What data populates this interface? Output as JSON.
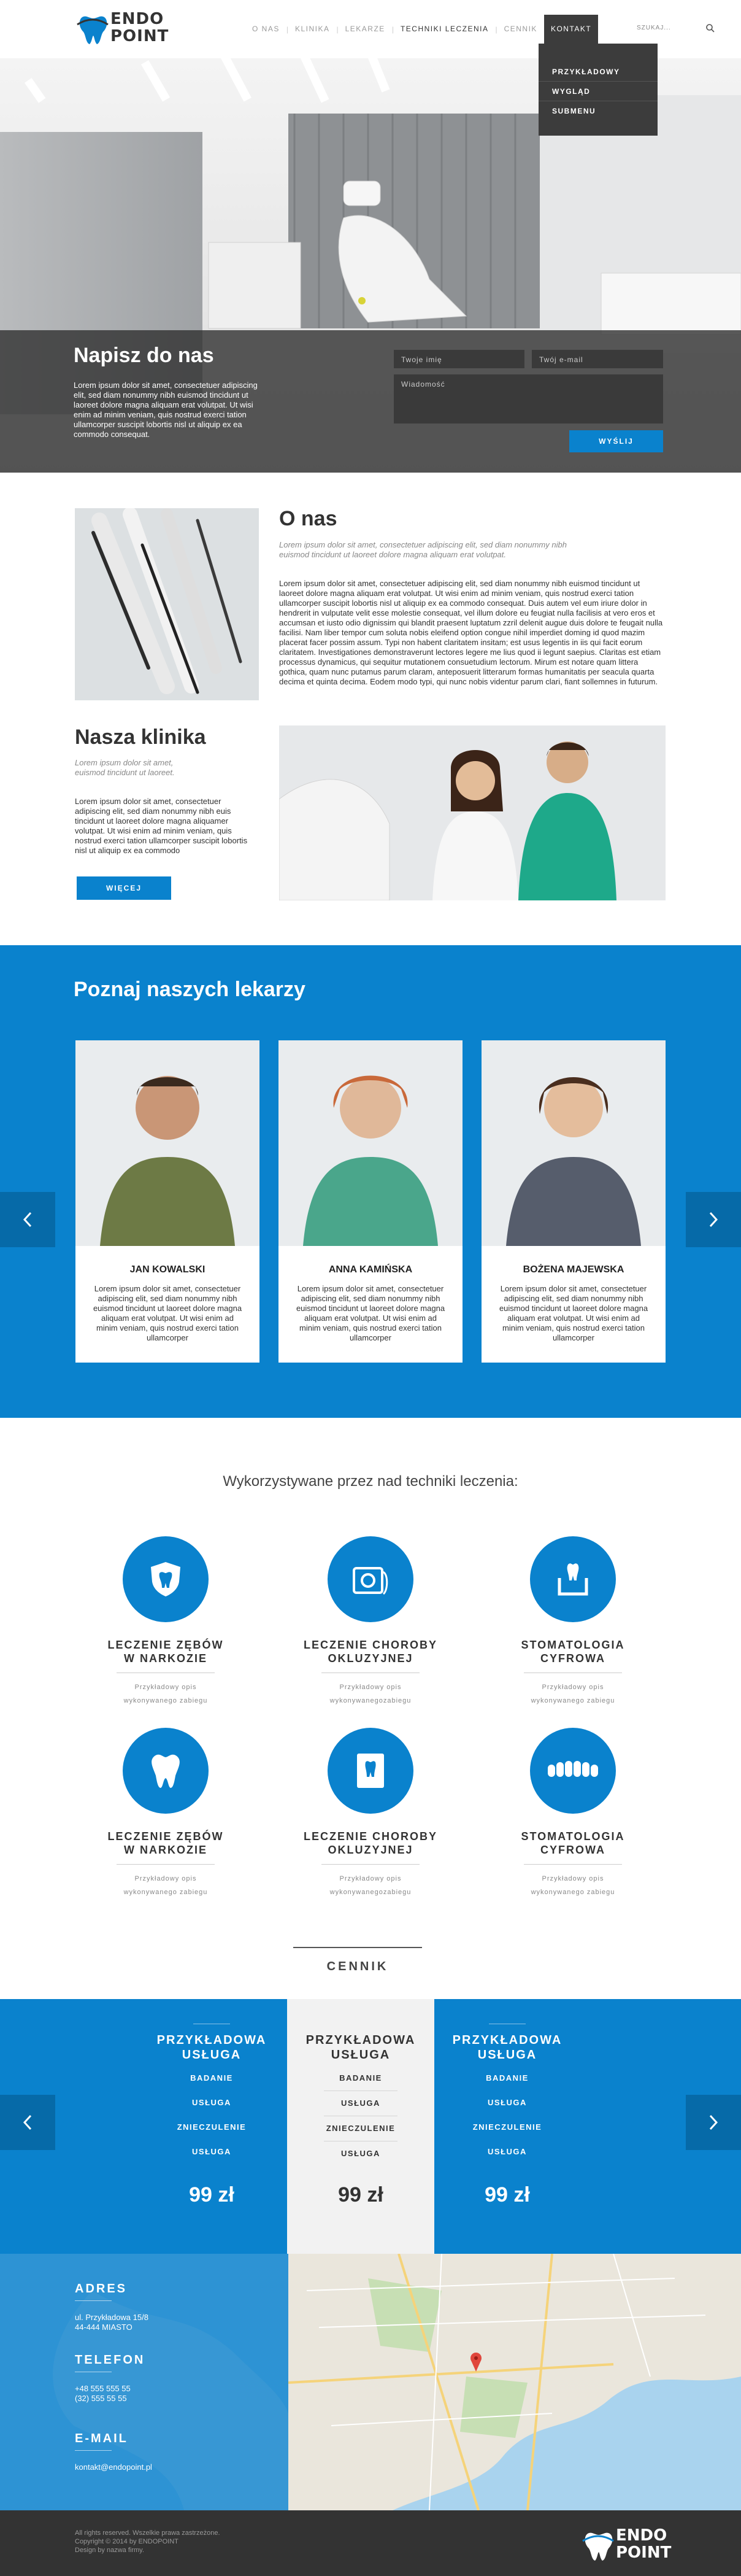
{
  "brand": {
    "line1": "ENDO",
    "line2": "POINT"
  },
  "nav": {
    "items": [
      "O NAS",
      "KLINIKA",
      "LEKARZE",
      "TECHNIKI LECZENIA",
      "CENNIK",
      "KONTAKT"
    ],
    "search_label": "SZUKAJ..."
  },
  "dropdown": {
    "items": [
      "PRZYKŁADOWY",
      "WYGLĄD",
      "SUBMENU"
    ]
  },
  "hero": {
    "title": "Napisz do nas",
    "text": "Lorem ipsum dolor sit amet, consectetuer adipiscing elit, sed diam nonummy nibh euismod tincidunt ut laoreet dolore magna aliquam erat volutpat. Ut wisi enim ad minim veniam, quis nostrud exerci tation ullamcorper suscipit lobortis nisl ut aliquip ex ea commodo consequat.",
    "name_placeholder": "Twoje imię",
    "email_placeholder": "Twój e-mail",
    "message_placeholder": "Wiadomość",
    "submit": "WYŚLIJ"
  },
  "onas": {
    "title": "O nas",
    "lead": "Lorem ipsum dolor sit amet, consectetuer adipiscing elit, sed diam nonummy nibh euismod tincidunt ut laoreet dolore magna aliquam erat volutpat.",
    "body": "Lorem ipsum dolor sit amet, consectetuer adipiscing elit, sed diam nonummy nibh euismod tincidunt ut laoreet dolore magna aliquam erat volutpat. Ut wisi enim ad minim veniam, quis nostrud exerci tation ullamcorper suscipit lobortis nisl ut aliquip ex ea commodo consequat. Duis autem vel eum iriure dolor in hendrerit in vulputate velit esse molestie consequat, vel illum dolore eu feugiat nulla facilisis at vero eros et accumsan et iusto odio dignissim qui blandit praesent luptatum zzril delenit augue duis dolore te feugait nulla facilisi. Nam liber tempor cum soluta nobis eleifend option congue nihil imperdiet doming id quod mazim placerat facer possim assum. Typi non habent claritatem insitam; est usus legentis in iis qui facit eorum claritatem. Investigationes demonstraverunt lectores legere me lius quod ii legunt saepius. Claritas est etiam processus dynamicus, qui sequitur mutationem consuetudium lectorum. Mirum est notare quam littera gothica, quam nunc putamus parum claram, anteposuerit litterarum formas humanitatis per seacula quarta decima et quinta decima. Eodem modo typi, qui nunc nobis videntur parum clari, fiant sollemnes in futurum."
  },
  "klinika": {
    "title": "Nasza klinika",
    "lead": "Lorem ipsum dolor sit amet, euismod tincidunt ut laoreet.",
    "body": "Lorem ipsum dolor sit amet, consectetuer adipiscing elit, sed diam nonummy nibh euis tincidunt ut laoreet dolore magna aliquamer volutpat. Ut wisi enim ad minim veniam, quis nostrud exerci tation ullamcorper suscipit lobortis nisl ut aliquip ex ea commodo",
    "button": "WIĘCEJ"
  },
  "lekarze": {
    "title": "Poznaj naszych lekarzy",
    "doctors": [
      {
        "name": "JAN KOWALSKI",
        "desc": "Lorem ipsum dolor sit amet, consectetuer adipiscing elit, sed diam nonummy nibh euismod tincidunt ut laoreet dolore magna aliquam erat volutpat. Ut wisi enim ad minim veniam, quis nostrud exerci tation ullamcorper"
      },
      {
        "name": "ANNA KAMIŃSKA",
        "desc": "Lorem ipsum dolor sit amet, consectetuer adipiscing elit, sed diam nonummy nibh euismod tincidunt ut laoreet dolore magna aliquam erat volutpat. Ut wisi enim ad minim veniam, quis nostrud exerci tation ullamcorper"
      },
      {
        "name": "BOŻENA MAJEWSKA",
        "desc": "Lorem ipsum dolor sit amet, consectetuer adipiscing elit, sed diam nonummy nibh euismod tincidunt ut laoreet dolore magna aliquam erat volutpat. Ut wisi enim ad minim veniam, quis nostrud exerci tation ullamcorper"
      }
    ]
  },
  "techniki": {
    "heading": "Wykorzystywane przez nad techniki leczenia:",
    "items": [
      {
        "title1": "LECZENIE ZĘBÓW",
        "title2": "W NARKOZIE",
        "sub1": "Przykładowy opis",
        "sub2": "wykonywanego zabiegu",
        "icon": "tooth-shield-icon"
      },
      {
        "title1": "LECZENIE CHOROBY",
        "title2": "OKLUZYJNEJ",
        "sub1": "Przykładowy opis",
        "sub2": "wykonywanegozabiegu",
        "icon": "floss-icon"
      },
      {
        "title1": "STOMATOLOGIA",
        "title2": "CYFROWA",
        "sub1": "Przykładowy opis",
        "sub2": "wykonywanego zabiegu",
        "icon": "tooth-box-icon"
      },
      {
        "title1": "LECZENIE ZĘBÓW",
        "title2": "W NARKOZIE",
        "sub1": "Przykładowy opis",
        "sub2": "wykonywanego zabiegu",
        "icon": "tooth-icon"
      },
      {
        "title1": "LECZENIE CHOROBY",
        "title2": "OKLUZYJNEJ",
        "sub1": "Przykładowy opis",
        "sub2": "wykonywanegozabiegu",
        "icon": "xray-icon"
      },
      {
        "title1": "STOMATOLOGIA",
        "title2": "CYFROWA",
        "sub1": "Przykładowy opis",
        "sub2": "wykonywanego zabiegu",
        "icon": "teeth-row-icon"
      }
    ]
  },
  "cennik": {
    "heading": "CENNIK",
    "plans": [
      {
        "title1": "PRZYKŁADOWA",
        "title2": "USŁUGA",
        "items": [
          "BADANIE",
          "USŁUGA",
          "ZNIECZULENIE",
          "USŁUGA"
        ],
        "price": "99 zł"
      },
      {
        "title1": "PRZYKŁADOWA",
        "title2": "USŁUGA",
        "items": [
          "BADANIE",
          "USŁUGA",
          "ZNIECZULENIE",
          "USŁUGA"
        ],
        "price": "99 zł"
      },
      {
        "title1": "PRZYKŁADOWA",
        "title2": "USŁUGA",
        "items": [
          "BADANIE",
          "USŁUGA",
          "ZNIECZULENIE",
          "USŁUGA"
        ],
        "price": "99 zł"
      }
    ]
  },
  "contact": {
    "address_label": "ADRES",
    "address1": "ul. Przykładowa 15/8",
    "address2": "44-444 MIASTO",
    "phone_label": "TELEFON",
    "phone1": "+48 555 555 55",
    "phone2": "(32) 555 55 55",
    "email_label": "E-MAIL",
    "email": "kontakt@endopoint.pl"
  },
  "footer": {
    "line1": "All rights reserved. Wszelkie prawa zastrzeżone.",
    "line2": "Copyright © 2014 by ENDOPOINT",
    "line3": "Design by nazwa firmy."
  },
  "colors": {
    "accent": "#0a82cd",
    "dark": "#333333",
    "accent_dark": "#066aa8"
  }
}
